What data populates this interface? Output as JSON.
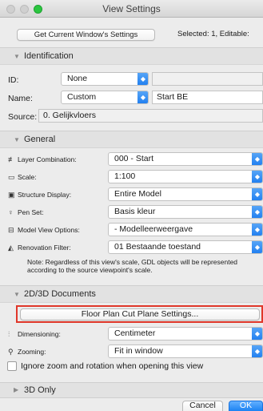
{
  "window": {
    "title": "View Settings"
  },
  "toolbar": {
    "get_settings_label": "Get Current Window's Settings",
    "selected_status": "Selected: 1, Editable:"
  },
  "identification": {
    "header": "Identification",
    "id_label": "ID:",
    "id_value": "None",
    "id_text": "",
    "name_label": "Name:",
    "name_value": "Custom",
    "name_text": "Start BE",
    "source_label": "Source:",
    "source_value": "0. Gelijkvloers"
  },
  "general": {
    "header": "General",
    "rows": [
      {
        "icon": "layer-combination-icon",
        "glyph": "≢",
        "label": "Layer Combination:",
        "value": "000 - Start"
      },
      {
        "icon": "scale-icon",
        "glyph": "▭",
        "label": "Scale:",
        "value": "1:100"
      },
      {
        "icon": "structure-display-icon",
        "glyph": "▣",
        "label": "Structure Display:",
        "value": "Entire Model"
      },
      {
        "icon": "pen-set-icon",
        "glyph": "♀",
        "label": "Pen Set:",
        "value": "Basis kleur"
      },
      {
        "icon": "model-view-options-icon",
        "glyph": "⊟",
        "label": "Model View Options:",
        "value": "- Modelleerweergave"
      },
      {
        "icon": "renovation-filter-icon",
        "glyph": "◭",
        "label": "Renovation Filter:",
        "value": "01 Bestaande toestand"
      }
    ],
    "note_line1": "Note: Regardless of this view's scale, GDL objects will be represented",
    "note_line2": "according to the source viewpoint's scale."
  },
  "documents": {
    "header": "2D/3D Documents",
    "floor_plan_button": "Floor Plan Cut Plane Settings...",
    "dimensioning_label": "Dimensioning:",
    "dimensioning_value": "Centimeter",
    "zooming_label": "Zooming:",
    "zooming_value": "Fit in window",
    "ignore_zoom_label": "Ignore zoom and rotation when opening this view"
  },
  "only3d": {
    "header": "3D Only"
  },
  "footer": {
    "cancel_label": "Cancel",
    "ok_label": "OK"
  },
  "colors": {
    "accent": "#1f7ef0",
    "highlight": "#e0372a",
    "zoom_button": "#2bc640"
  }
}
